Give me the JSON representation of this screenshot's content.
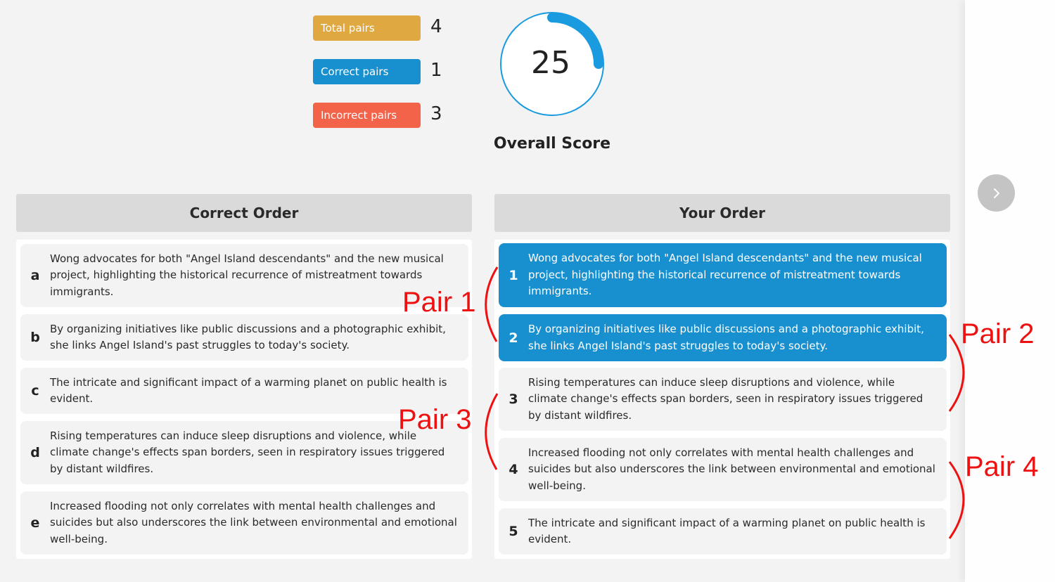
{
  "stats": {
    "total": {
      "label": "Total pairs",
      "value": "4",
      "color": "#dfa841"
    },
    "correct": {
      "label": "Correct pairs",
      "value": "1",
      "color": "#1890d0"
    },
    "incorrect": {
      "label": "Incorrect pairs",
      "value": "3",
      "color": "#f2634a"
    }
  },
  "score": {
    "value": "25",
    "percent": 25,
    "label": "Overall Score",
    "color": "#1a9be0"
  },
  "correct_order": {
    "title": "Correct Order",
    "items": [
      {
        "key": "a",
        "text": "Wong advocates for both \"Angel Island descendants\" and the new musical project, highlighting the historical recurrence of mistreatment towards immigrants."
      },
      {
        "key": "b",
        "text": "By organizing initiatives like public discussions and a photographic exhibit, she links Angel Island's past struggles to today's society."
      },
      {
        "key": "c",
        "text": "The intricate and significant impact of a warming planet on public health is evident."
      },
      {
        "key": "d",
        "text": "Rising temperatures can induce sleep disruptions and violence, while climate change's effects span borders, seen in respiratory issues triggered by distant wildfires."
      },
      {
        "key": "e",
        "text": "Increased flooding not only correlates with mental health challenges and suicides but also underscores the link between environmental and emotional well-being."
      }
    ]
  },
  "your_order": {
    "title": "Your Order",
    "items": [
      {
        "key": "1",
        "text": "Wong advocates for both \"Angel Island descendants\" and the new musical project, highlighting the historical recurrence of mistreatment towards immigrants.",
        "correct": true
      },
      {
        "key": "2",
        "text": "By organizing initiatives like public discussions and a photographic exhibit, she links Angel Island's past struggles to today's society.",
        "correct": true
      },
      {
        "key": "3",
        "text": "Rising temperatures can induce sleep disruptions and violence, while climate change's effects span borders, seen in respiratory issues triggered by distant wildfires.",
        "correct": false
      },
      {
        "key": "4",
        "text": "Increased flooding not only correlates with mental health challenges and suicides but also underscores the link between environmental and emotional well-being.",
        "correct": false
      },
      {
        "key": "5",
        "text": "The intricate and significant impact of a warming planet on public health is evident.",
        "correct": false
      }
    ]
  },
  "next_button": {
    "icon": "chevron-right-icon"
  },
  "annotations": {
    "pair1": "Pair 1",
    "pair2": "Pair 2",
    "pair3": "Pair 3",
    "pair4": "Pair 4",
    "color": "#ee1111"
  }
}
